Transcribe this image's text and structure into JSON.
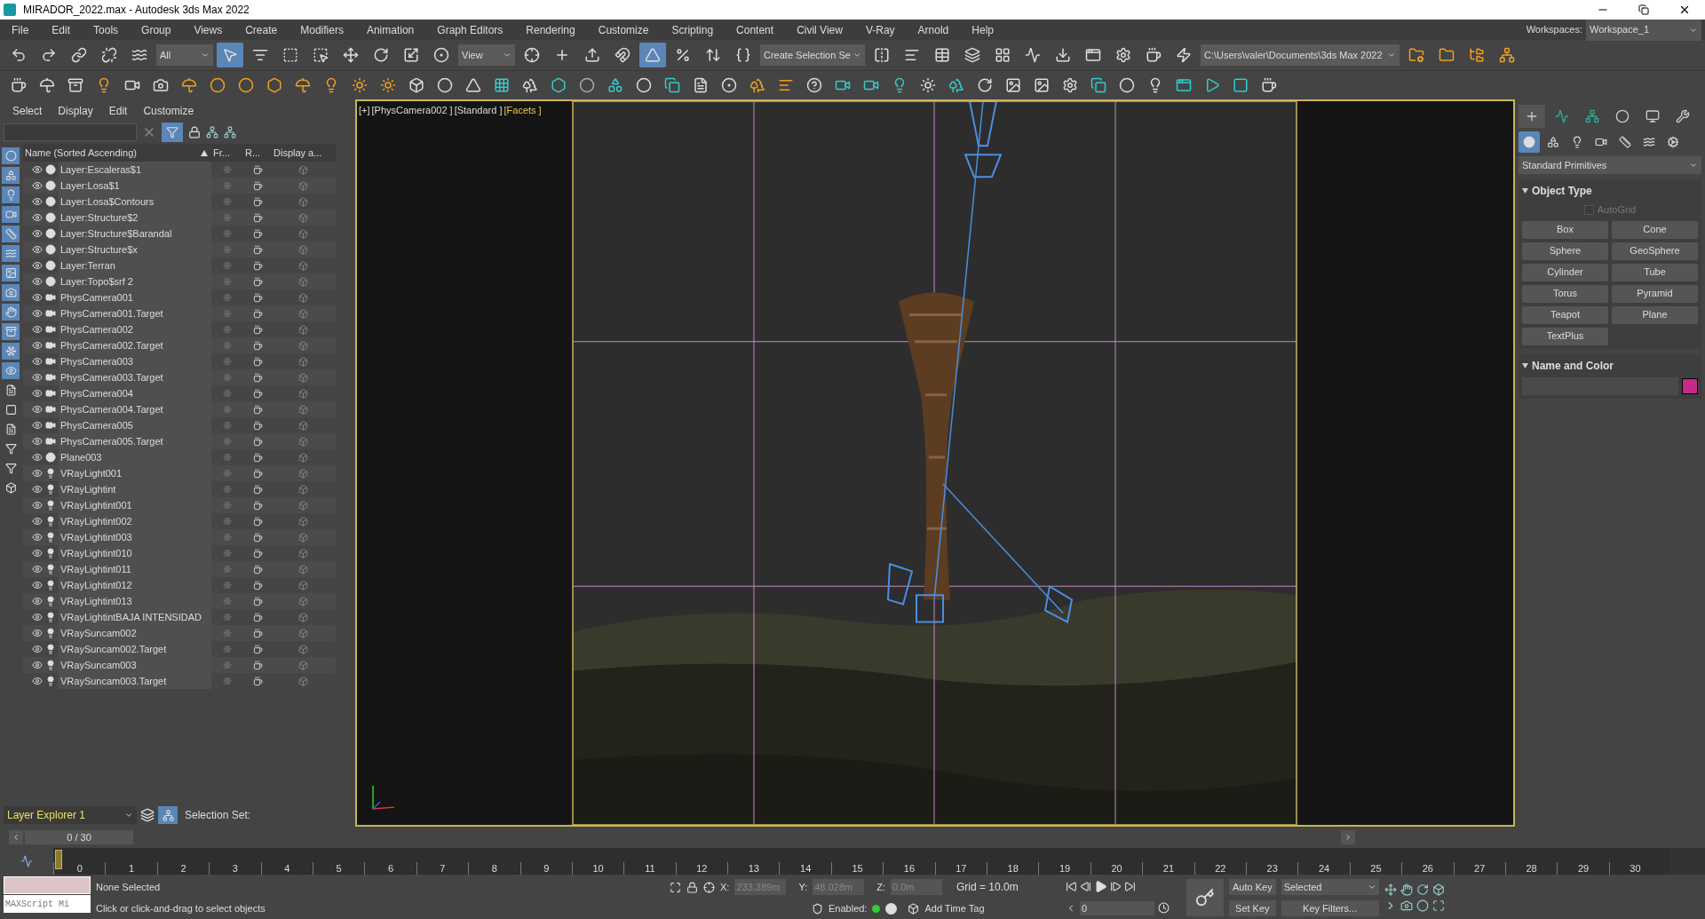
{
  "window": {
    "title": "MIRADOR_2022.max - Autodesk 3ds Max 2022"
  },
  "menu": [
    "File",
    "Edit",
    "Tools",
    "Group",
    "Views",
    "Create",
    "Modifiers",
    "Animation",
    "Graph Editors",
    "Rendering",
    "Customize",
    "Scripting",
    "Content",
    "Civil View",
    "V-Ray",
    "Arnold",
    "Help"
  ],
  "workspaces": {
    "label": "Workspaces:",
    "value": "Workspace_1"
  },
  "main_toolbar": [
    {
      "kind": "button",
      "selected": false
    },
    {
      "kind": "button",
      "selected": false
    },
    {
      "kind": "button",
      "selected": false
    },
    {
      "kind": "button",
      "selected": false
    },
    {
      "kind": "button",
      "selected": false
    },
    {
      "kind": "dropdown",
      "value": "All"
    },
    {
      "kind": "button",
      "selected": true
    },
    {
      "kind": "button",
      "selected": false
    },
    {
      "kind": "button",
      "selected": false
    },
    {
      "kind": "button",
      "selected": false
    },
    {
      "kind": "button",
      "selected": false
    },
    {
      "kind": "button",
      "selected": false
    },
    {
      "kind": "button",
      "selected": false
    },
    {
      "kind": "button",
      "selected": false
    },
    {
      "kind": "dropdown",
      "value": "View"
    },
    {
      "kind": "button",
      "selected": false
    },
    {
      "kind": "button",
      "selected": false
    },
    {
      "kind": "button",
      "selected": false
    },
    {
      "kind": "button",
      "selected": false
    },
    {
      "kind": "button",
      "selected": true
    },
    {
      "kind": "button",
      "selected": false
    },
    {
      "kind": "button",
      "selected": false
    },
    {
      "kind": "button",
      "selected": false
    },
    {
      "kind": "dropdown",
      "value": "Create Selection Se"
    },
    {
      "kind": "button",
      "selected": false
    },
    {
      "kind": "button",
      "selected": false
    },
    {
      "kind": "button",
      "selected": false
    },
    {
      "kind": "button",
      "selected": false
    },
    {
      "kind": "button",
      "selected": false
    },
    {
      "kind": "button",
      "selected": false
    },
    {
      "kind": "button",
      "selected": false
    },
    {
      "kind": "button",
      "selected": false
    },
    {
      "kind": "button",
      "selected": false
    },
    {
      "kind": "button",
      "selected": false
    },
    {
      "kind": "button",
      "selected": false
    },
    {
      "kind": "dropdown",
      "value": "C:\\Users\\valer\\Documents\\3ds Max 2022"
    },
    {
      "kind": "button",
      "selected": false
    },
    {
      "kind": "button",
      "selected": false
    },
    {
      "kind": "button",
      "selected": false
    },
    {
      "kind": "button",
      "selected": false
    }
  ],
  "scene_explorer": {
    "menu": [
      "Select",
      "Display",
      "Edit",
      "Customize"
    ],
    "filters": [
      {
        "on": true
      },
      {
        "on": true
      },
      {
        "on": true
      },
      {
        "on": true
      },
      {
        "on": true
      },
      {
        "on": true
      },
      {
        "on": true
      },
      {
        "on": true
      },
      {
        "on": true
      },
      {
        "on": true
      },
      {
        "on": true
      },
      {
        "on": true
      },
      {
        "on": false
      },
      {
        "on": false
      },
      {
        "on": false
      },
      {
        "on": false
      },
      {
        "on": false
      },
      {
        "on": false
      }
    ],
    "columns": [
      "Name (Sorted Ascending)",
      "Fr...",
      "R...",
      "Display a..."
    ],
    "rows": [
      {
        "name": "Layer:Escaleras$1",
        "kind": "layer"
      },
      {
        "name": "Layer:Losa$1",
        "kind": "layer"
      },
      {
        "name": "Layer:Losa$Contours",
        "kind": "layer"
      },
      {
        "name": "Layer:Structure$2",
        "kind": "layer"
      },
      {
        "name": "Layer:Structure$Barandal",
        "kind": "layer"
      },
      {
        "name": "Layer:Structure$x",
        "kind": "layer"
      },
      {
        "name": "Layer:Terran",
        "kind": "layer"
      },
      {
        "name": "Layer:Topo$srf 2",
        "kind": "layer"
      },
      {
        "name": "PhysCamera001",
        "kind": "camera"
      },
      {
        "name": "PhysCamera001.Target",
        "kind": "camera"
      },
      {
        "name": "PhysCamera002",
        "kind": "camera"
      },
      {
        "name": "PhysCamera002.Target",
        "kind": "camera"
      },
      {
        "name": "PhysCamera003",
        "kind": "camera"
      },
      {
        "name": "PhysCamera003.Target",
        "kind": "camera"
      },
      {
        "name": "PhysCamera004",
        "kind": "camera"
      },
      {
        "name": "PhysCamera004.Target",
        "kind": "camera"
      },
      {
        "name": "PhysCamera005",
        "kind": "camera"
      },
      {
        "name": "PhysCamera005.Target",
        "kind": "camera"
      },
      {
        "name": "Plane003",
        "kind": "layer"
      },
      {
        "name": "VRayLight001",
        "kind": "light"
      },
      {
        "name": "VRayLightint",
        "kind": "light"
      },
      {
        "name": "VRayLightint001",
        "kind": "light"
      },
      {
        "name": "VRayLightint002",
        "kind": "light"
      },
      {
        "name": "VRayLightint003",
        "kind": "light"
      },
      {
        "name": "VRayLightint010",
        "kind": "light"
      },
      {
        "name": "VRayLightint011",
        "kind": "light"
      },
      {
        "name": "VRayLightint012",
        "kind": "light"
      },
      {
        "name": "VRayLightint013",
        "kind": "light"
      },
      {
        "name": "VRayLightintBAJA INTENSIDAD",
        "kind": "light"
      },
      {
        "name": "VRaySuncam002",
        "kind": "light"
      },
      {
        "name": "VRaySuncam002.Target",
        "kind": "light"
      },
      {
        "name": "VRaySuncam003",
        "kind": "light"
      },
      {
        "name": "VRaySuncam003.Target",
        "kind": "light"
      }
    ],
    "explorer_name": "Layer Explorer 1",
    "selection_set_label": "Selection Set:",
    "frame_counter": "0 / 30",
    "frame_slider": {
      "level": 0
    }
  },
  "viewport": {
    "labels": [
      {
        "text": "[+]",
        "kind": "plain"
      },
      {
        "text": "[PhysCamera002 ]",
        "kind": "plain"
      },
      {
        "text": "[Standard ]",
        "kind": "plain"
      },
      {
        "text": "[Facets ]",
        "kind": "highlight"
      }
    ]
  },
  "command_panel": {
    "tabs": [
      {
        "selected": true
      },
      {
        "selected": false
      },
      {
        "selected": false
      },
      {
        "selected": false
      },
      {
        "selected": false
      },
      {
        "selected": false
      }
    ],
    "categories": [
      {
        "selected": true
      },
      {
        "selected": false
      },
      {
        "selected": false
      },
      {
        "selected": false
      },
      {
        "selected": false
      },
      {
        "selected": false
      },
      {
        "selected": false
      }
    ],
    "dropdown": "Standard Primitives",
    "object_type": {
      "title": "Object Type",
      "autogrid": {
        "label": "AutoGrid",
        "checked": false
      },
      "buttons": [
        "Box",
        "Cone",
        "Sphere",
        "GeoSphere",
        "Cylinder",
        "Tube",
        "Torus",
        "Pyramid",
        "Teapot",
        "Plane",
        "TextPlus"
      ]
    },
    "name_and_color": {
      "title": "Name and Color",
      "color": "#c8288c"
    }
  },
  "timeline": {
    "ticks": [
      "0",
      "1",
      "2",
      "3",
      "4",
      "5",
      "6",
      "7",
      "8",
      "9",
      "10",
      "11",
      "12",
      "13",
      "14",
      "15",
      "16",
      "17",
      "18",
      "19",
      "20",
      "21",
      "22",
      "23",
      "24",
      "25",
      "26",
      "27",
      "28",
      "29",
      "30"
    ]
  },
  "status": {
    "maxscript_placeholder": "MAXScript Mi",
    "selection": "None Selected",
    "prompt": "Click or click-and-drag to select objects",
    "x_label": "X:",
    "x": "233.389m",
    "y_label": "Y:",
    "y": "48.028m",
    "z_label": "Z:",
    "z": "0.0m",
    "grid": "Grid = 10.0m",
    "enabled_label": "Enabled:",
    "time_tag": "Add Time Tag",
    "frame": "0",
    "auto_key": "Auto Key",
    "key_mode": "Selected",
    "set_key": "Set Key",
    "key_filters": "Key Filters..."
  }
}
